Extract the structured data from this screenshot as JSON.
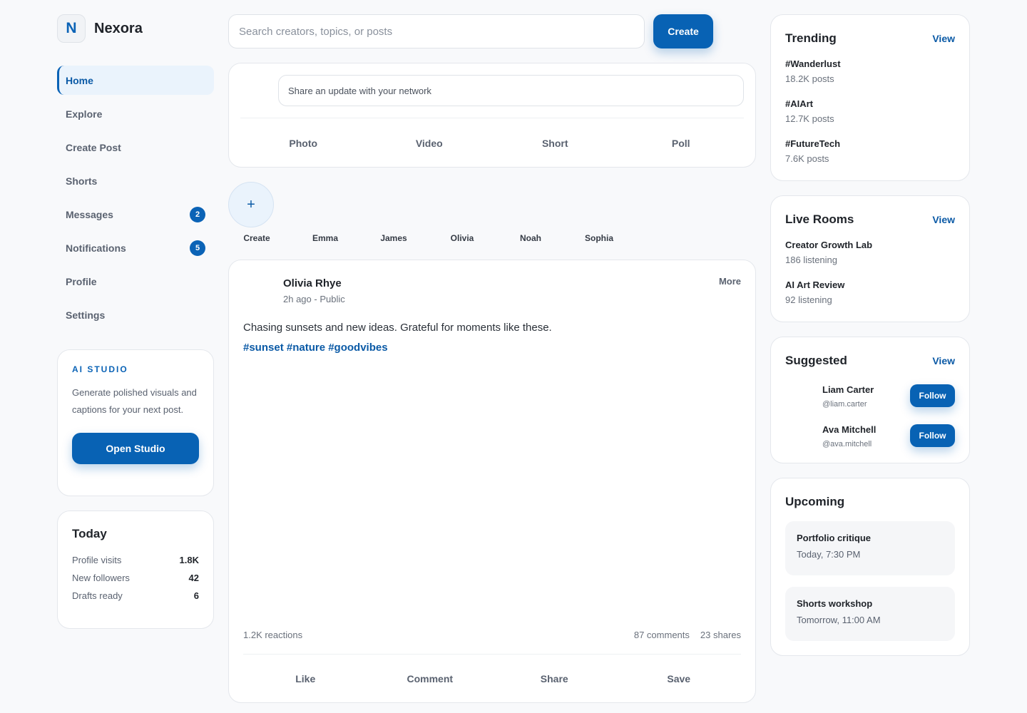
{
  "brand": {
    "mark": "N",
    "name": "Nexora"
  },
  "nav": [
    {
      "label": "Home",
      "active": true,
      "badge": null
    },
    {
      "label": "Explore",
      "active": false,
      "badge": null
    },
    {
      "label": "Create Post",
      "active": false,
      "badge": null
    },
    {
      "label": "Shorts",
      "active": false,
      "badge": null
    },
    {
      "label": "Messages",
      "active": false,
      "badge": "2"
    },
    {
      "label": "Notifications",
      "active": false,
      "badge": "5"
    },
    {
      "label": "Profile",
      "active": false,
      "badge": null
    },
    {
      "label": "Settings",
      "active": false,
      "badge": null
    }
  ],
  "studio": {
    "title": "AI STUDIO",
    "text": "Generate polished visuals and captions for your next post.",
    "button": "Open Studio"
  },
  "today": {
    "title": "Today",
    "stats": [
      {
        "label": "Profile visits",
        "value": "1.8K"
      },
      {
        "label": "New followers",
        "value": "42"
      },
      {
        "label": "Drafts ready",
        "value": "6"
      }
    ]
  },
  "search": {
    "placeholder": "Search creators, topics, or posts",
    "button": "Create"
  },
  "composer": {
    "placeholder": "Share an update with your network",
    "actions": [
      "Photo",
      "Video",
      "Short",
      "Poll"
    ]
  },
  "stories": {
    "add_symbol": "+",
    "labels": [
      "Create",
      "Emma",
      "James",
      "Olivia",
      "Noah",
      "Sophia"
    ]
  },
  "post": {
    "author": "Olivia Rhye",
    "meta": "2h ago - Public",
    "more": "More",
    "text": "Chasing sunsets and new ideas. Grateful for moments like these.",
    "tags": "#sunset #nature #goodvibes",
    "reactions": "1.2K reactions",
    "comments": "87 comments",
    "shares": "23 shares",
    "actions": [
      "Like",
      "Comment",
      "Share",
      "Save"
    ]
  },
  "trending": {
    "title": "Trending",
    "link": "View",
    "items": [
      {
        "tag": "#Wanderlust",
        "count": "18.2K posts"
      },
      {
        "tag": "#AIArt",
        "count": "12.7K posts"
      },
      {
        "tag": "#FutureTech",
        "count": "7.6K posts"
      }
    ]
  },
  "live": {
    "title": "Live Rooms",
    "link": "View",
    "items": [
      {
        "name": "Creator Growth Lab",
        "listeners": "186 listening"
      },
      {
        "name": "AI Art Review",
        "listeners": "92 listening"
      }
    ]
  },
  "suggested": {
    "title": "Suggested",
    "link": "View",
    "items": [
      {
        "name": "Liam Carter",
        "handle": "@liam.carter",
        "button": "Follow"
      },
      {
        "name": "Ava Mitchell",
        "handle": "@ava.mitchell",
        "button": "Follow"
      }
    ]
  },
  "upcoming": {
    "title": "Upcoming",
    "items": [
      {
        "name": "Portfolio critique",
        "time": "Today, 7:30 PM"
      },
      {
        "name": "Shorts workshop",
        "time": "Tomorrow, 11:00 AM"
      }
    ]
  },
  "colors": {
    "accent": "#0b63b6",
    "accent_light": "#eaf3fc",
    "background": "#f8f9fb",
    "border": "#e4e7ec"
  }
}
